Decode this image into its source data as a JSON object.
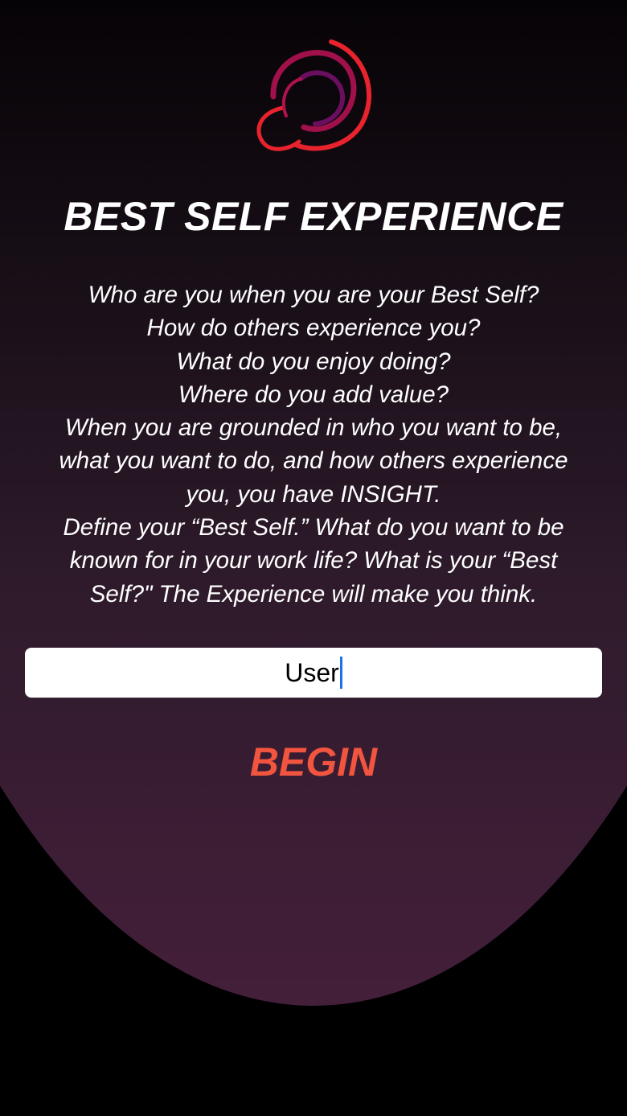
{
  "app": {
    "title": "BEST SELF EXPERIENCE",
    "logo_icon": "swirl-logo-icon"
  },
  "intro": {
    "lines": [
      "Who are you when you are your Best Self?",
      "How do others experience you?",
      "What do you enjoy doing?",
      "Where do you add value?",
      "When you are grounded in who you want to be,",
      "what you want to do, and how others experience",
      "you, you have INSIGHT.",
      "Define your “Best Self.” What do you want to be",
      "known for in your work life? What is your “Best",
      "Self?\" The Experience will make you think."
    ]
  },
  "form": {
    "name_value": "User"
  },
  "actions": {
    "begin_label": "BEGIN"
  },
  "colors": {
    "accent": "#f1553f",
    "logo_red": "#e8232d",
    "logo_magenta": "#a0104a",
    "logo_purple": "#6a0f5f",
    "caret": "#1a73e8"
  }
}
